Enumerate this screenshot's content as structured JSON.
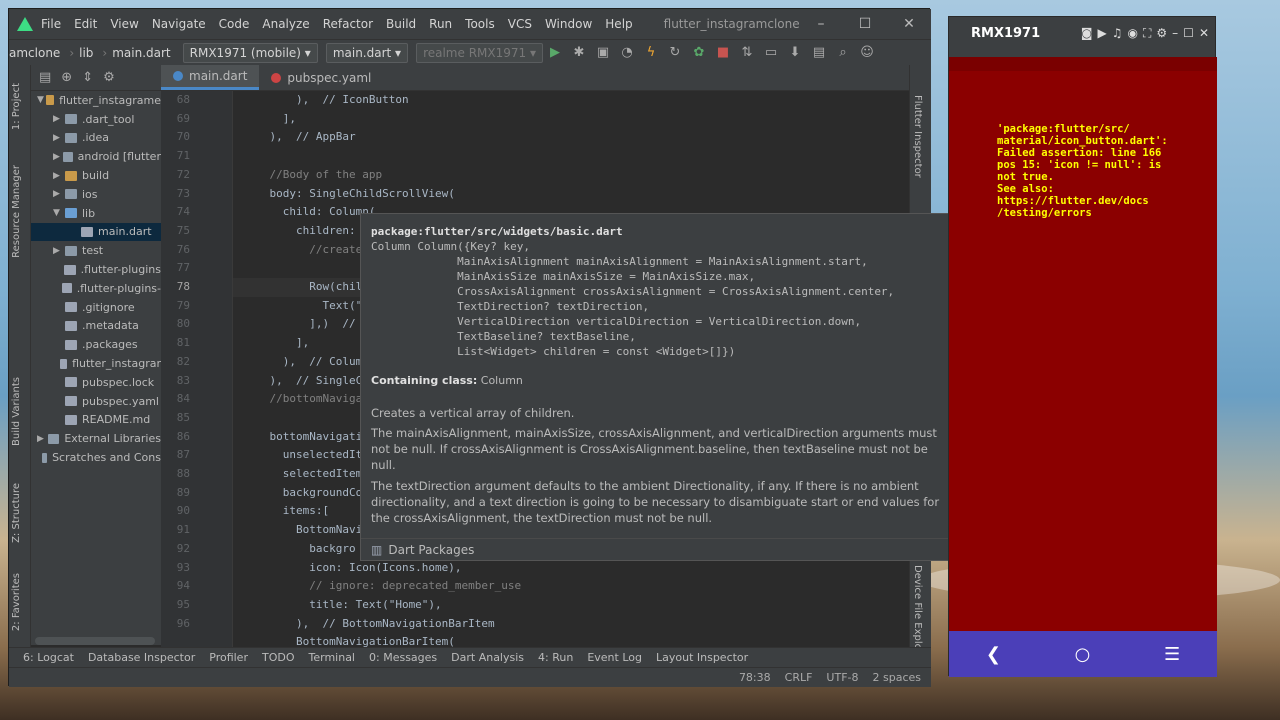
{
  "ide": {
    "menu": [
      "File",
      "Edit",
      "View",
      "Navigate",
      "Code",
      "Analyze",
      "Refactor",
      "Build",
      "Run",
      "Tools",
      "VCS",
      "Window",
      "Help"
    ],
    "project_title": "flutter_instagramclone",
    "breadcrumbs": [
      "amclone",
      "lib",
      "main.dart"
    ],
    "device_combo": "RMX1971 (mobile)",
    "config_combo": "main.dart",
    "target_combo": "realme RMX1971",
    "tabs": [
      {
        "label": "main.dart",
        "active": true
      },
      {
        "label": "pubspec.yaml",
        "active": false
      }
    ],
    "tree": [
      {
        "label": "flutter_instagrame",
        "depth": 0,
        "open": true,
        "kind": "fold-o"
      },
      {
        "label": ".dart_tool",
        "depth": 1,
        "open": false,
        "kind": "fold"
      },
      {
        "label": ".idea",
        "depth": 1,
        "open": false,
        "kind": "fold"
      },
      {
        "label": "android [flutter",
        "depth": 1,
        "open": false,
        "kind": "fold"
      },
      {
        "label": "build",
        "depth": 1,
        "open": false,
        "kind": "fold-o"
      },
      {
        "label": "ios",
        "depth": 1,
        "open": false,
        "kind": "fold"
      },
      {
        "label": "lib",
        "depth": 1,
        "open": true,
        "kind": "fold-b"
      },
      {
        "label": "main.dart",
        "depth": 2,
        "open": null,
        "kind": "file",
        "selected": true
      },
      {
        "label": "test",
        "depth": 1,
        "open": false,
        "kind": "fold"
      },
      {
        "label": ".flutter-plugins",
        "depth": 1,
        "open": null,
        "kind": "file"
      },
      {
        "label": ".flutter-plugins-",
        "depth": 1,
        "open": null,
        "kind": "file"
      },
      {
        "label": ".gitignore",
        "depth": 1,
        "open": null,
        "kind": "file"
      },
      {
        "label": ".metadata",
        "depth": 1,
        "open": null,
        "kind": "file"
      },
      {
        "label": ".packages",
        "depth": 1,
        "open": null,
        "kind": "file"
      },
      {
        "label": "flutter_instagrar",
        "depth": 1,
        "open": null,
        "kind": "file"
      },
      {
        "label": "pubspec.lock",
        "depth": 1,
        "open": null,
        "kind": "file"
      },
      {
        "label": "pubspec.yaml",
        "depth": 1,
        "open": null,
        "kind": "file"
      },
      {
        "label": "README.md",
        "depth": 1,
        "open": null,
        "kind": "file"
      },
      {
        "label": "External Libraries",
        "depth": 0,
        "open": false,
        "kind": "fold"
      },
      {
        "label": "Scratches and Cons",
        "depth": 0,
        "open": null,
        "kind": "fold"
      }
    ],
    "left_stripe": [
      "1: Project",
      "Resource Manager",
      "Build Variants",
      "Z: Structure",
      "2: Favorites"
    ],
    "right_stripe": [
      "Flutter Inspector",
      "Device File Explorer"
    ],
    "line_numbers": [
      "68",
      "69",
      "70",
      "71",
      "72",
      "73",
      "74",
      "75",
      "76",
      "77",
      "78",
      "79",
      "80",
      "81",
      "82",
      "83",
      "84",
      "85",
      "86",
      "87",
      "88",
      "89",
      "90",
      "91",
      "92",
      "93",
      "94",
      "95",
      "96"
    ],
    "current_line": "78",
    "code_lines": [
      "        ),  // IconButton",
      "      ],",
      "    ),  // AppBar",
      "",
      "    //Body of the app",
      "    body: SingleChildScrollView(",
      "      child: Column(",
      "        children: [",
      "          //create",
      "",
      "          Row(child",
      "            Text(\"S",
      "          ],)  // R",
      "        ],",
      "      ),  // Column",
      "    ),  // SingleCh",
      "    //bottomNavigat",
      "",
      "    bottomNavigatio",
      "      unselectedIte",
      "      selectedItemC",
      "      backgroundCol",
      "      items:[",
      "        BottomNavig",
      "          backgro",
      "          icon: Icon(Icons.home),",
      "          // ignore: deprecated_member_use",
      "          title: Text(\"Home\"),",
      "        ),  // BottomNavigationBarItem",
      "        BottomNavigationBarItem("
    ],
    "bottom_tools": [
      "6: Logcat",
      "Database Inspector",
      "Profiler",
      "TODO",
      "Terminal",
      "0: Messages",
      "Dart Analysis",
      "4: Run",
      "Event Log",
      "Layout Inspector"
    ],
    "status": {
      "position": "78:38",
      "line_sep": "CRLF",
      "encoding": "UTF-8",
      "indent": "2 spaces"
    }
  },
  "popup": {
    "path": "package:flutter/src/widgets/basic.dart",
    "signature": "Column Column({Key? key,\n             MainAxisAlignment mainAxisAlignment = MainAxisAlignment.start,\n             MainAxisSize mainAxisSize = MainAxisSize.max,\n             CrossAxisAlignment crossAxisAlignment = CrossAxisAlignment.center,\n             TextDirection? textDirection,\n             VerticalDirection verticalDirection = VerticalDirection.down,\n             TextBaseline? textBaseline,\n             List<Widget> children = const <Widget>[]})",
    "containing_label": "Containing class:",
    "containing_class": "Column",
    "p1": "Creates a vertical array of children.",
    "p2": "The mainAxisAlignment, mainAxisSize, crossAxisAlignment, and verticalDirection arguments must not be null. If crossAxisAlignment is CrossAxisAlignment.baseline, then textBaseline must not be null.",
    "p3": "The textDirection argument defaults to the ambient Directionality, if any. If there is no ambient directionality, and a text direction is going to be necessary to disambiguate start or end values for the crossAxisAlignment, the textDirection must not be null.",
    "footer": "Dart Packages"
  },
  "emulator": {
    "title": "RMX1971",
    "error_text": "'package:flutter/src/\nmaterial/icon_button.dart':\nFailed assertion: line 166\npos 15: 'icon != null': is\nnot true.\nSee also:\nhttps://flutter.dev/docs\n/testing/errors"
  },
  "colors": {
    "error_bg": "#8b0000",
    "error_text": "#ffff00",
    "nav_bg": "#4b3fb8",
    "accent": "#4a88c7"
  }
}
